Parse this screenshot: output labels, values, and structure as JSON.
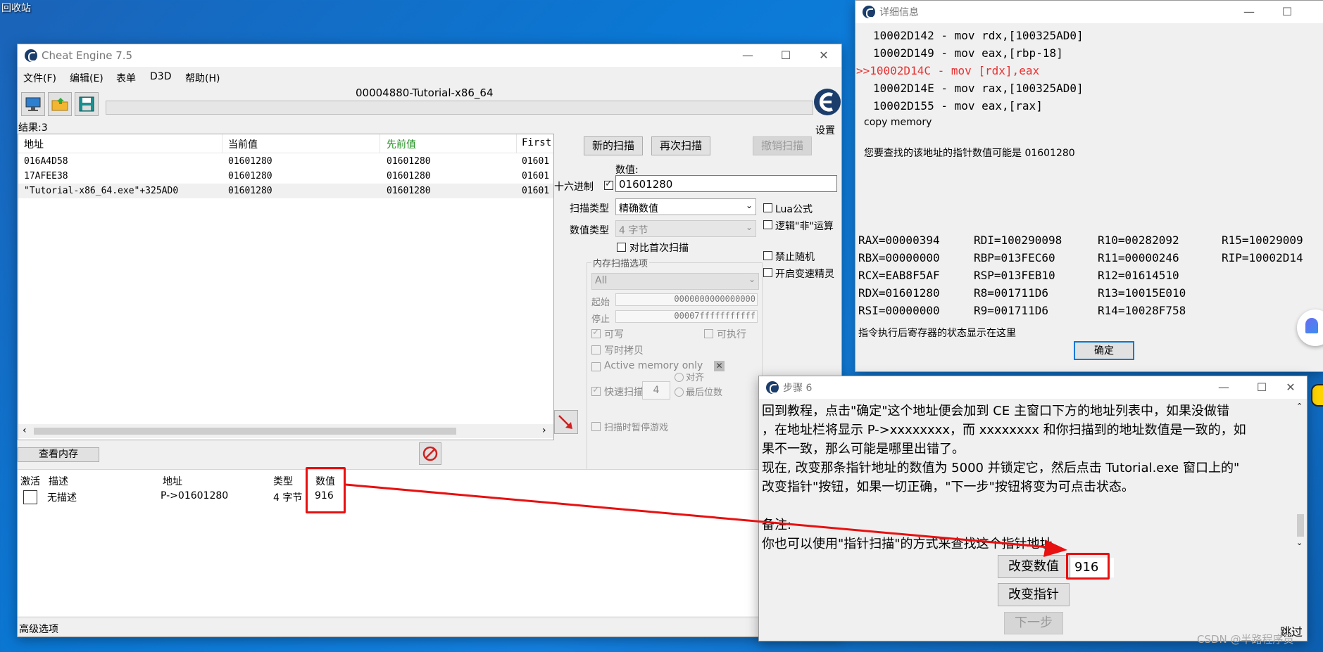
{
  "desktop": {
    "recycle_bin": "回收站"
  },
  "ce": {
    "title": "Cheat Engine 7.5",
    "menu": [
      "文件(F)",
      "编辑(E)",
      "表单",
      "D3D",
      "帮助(H)"
    ],
    "process_name": "00004880-Tutorial-x86_64",
    "settings_label": "设置",
    "results_label": "结果:3",
    "columns": [
      "地址",
      "当前值",
      "先前值",
      "First"
    ],
    "rows": [
      {
        "addr": "016A4D58",
        "cur": "01601280",
        "prev": "01601280",
        "first": "01601"
      },
      {
        "addr": "17AFEE38",
        "cur": "01601280",
        "prev": "01601280",
        "first": "01601"
      },
      {
        "addr": "\"Tutorial-x86_64.exe\"+325AD0",
        "cur": "01601280",
        "prev": "01601280",
        "first": "01601"
      }
    ],
    "new_scan": "新的扫描",
    "next_scan": "再次扫描",
    "undo_scan": "撤销扫描",
    "value_label": "数值:",
    "hex_label": "十六进制",
    "value": "01601280",
    "scan_type_label": "扫描类型",
    "scan_type": "精确数值",
    "value_type_label": "数值类型",
    "value_type": "4 字节",
    "compare_first": "对比首次扫描",
    "lua_formula": "Lua公式",
    "logic_not": "逻辑\"非\"运算",
    "no_random": "禁止随机",
    "speedhack": "开启变速精灵",
    "mem_opts_title": "内存扫描选项",
    "mem_region": "All",
    "start_label": "起始",
    "start_val": "0000000000000000",
    "stop_label": "停止",
    "stop_val": "00007fffffffffff",
    "writable": "可写",
    "executable": "可执行",
    "copy_on_write": "写时拷贝",
    "active_memory": "Active memory only",
    "fast_scan": "快速扫描",
    "fast_scan_val": "4",
    "align": "对齐",
    "last_digits": "最后位数",
    "pause_game": "扫描时暂停游戏",
    "view_memory": "查看内存",
    "list_columns": [
      "激活",
      "描述",
      "地址",
      "类型",
      "数值"
    ],
    "list_row": {
      "desc": "无描述",
      "addr": "P->01601280",
      "type": "4 字节",
      "value": "916"
    },
    "advanced": "高级选项"
  },
  "detail": {
    "title": "详细信息",
    "code": [
      {
        "text": "10002D142 - mov rdx,[100325AD0]",
        "hl": false
      },
      {
        "text": "10002D149 - mov eax,[rbp-18]",
        "hl": false
      },
      {
        "text": ">>10002D14C - mov [rdx],eax",
        "hl": true
      },
      {
        "text": "10002D14E - mov rax,[100325AD0]",
        "hl": false
      },
      {
        "text": "10002D155 - mov eax,[rax]",
        "hl": false
      }
    ],
    "copy_memory": "copy memory",
    "pointer_hint": "您要查找的该地址的指针数值可能是 01601280",
    "registers": [
      [
        "RAX=00000394",
        "RDI=100290098",
        "R10=00282092",
        "R15=10029009"
      ],
      [
        "RBX=00000000",
        "RBP=013FEC60",
        "R11=00000246",
        "RIP=10002D14"
      ],
      [
        "RCX=EAB8F5AF",
        "RSP=013FEB10",
        "R12=01614510",
        ""
      ],
      [
        "RDX=01601280",
        "R8=001711D6",
        "R13=10015E010",
        ""
      ],
      [
        "RSI=00000000",
        "R9=001711D6",
        "R14=10028F758",
        ""
      ]
    ],
    "reg_note": "指令执行后寄存器的状态显示在这里",
    "ok": "确定"
  },
  "step": {
    "title": "步骤 6",
    "text": [
      "回到教程，点击\"确定\"这个地址便会加到 CE 主窗口下方的地址列表中，如果没做错",
      "，在地址栏将显示 P->xxxxxxxx，而 xxxxxxxx 和你扫描到的地址数值是一致的，如",
      "果不一致，那么可能是哪里出错了。",
      "现在, 改变那条指针地址的数值为 5000 并锁定它，然后点击 Tutorial.exe 窗口上的\"",
      "改变指针\"按钮，如果一切正确，\"下一步\"按钮将变为可点击状态。",
      "",
      "备注:",
      "你也可以使用\"指针扫描\"的方式来查找这个指针地址。"
    ],
    "change_value": "改变数值",
    "value": "916",
    "change_pointer": "改变指针",
    "next": "下一步",
    "skip": "跳过"
  },
  "watermark": "CSDN @半路程序员"
}
